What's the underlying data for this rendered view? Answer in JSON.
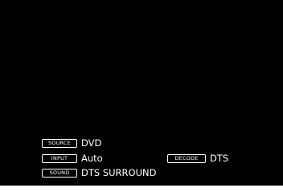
{
  "osd": {
    "source": {
      "tag": "SOURCE",
      "value": "DVD"
    },
    "input": {
      "tag": "INPUT",
      "value": "Auto"
    },
    "sound": {
      "tag": "SOUND",
      "value": "DTS SURROUND"
    },
    "decode": {
      "tag": "DECODE",
      "value": "DTS"
    }
  },
  "colors": {
    "background": "#000000",
    "text": "#ffffff",
    "frame": "#ffffff"
  }
}
